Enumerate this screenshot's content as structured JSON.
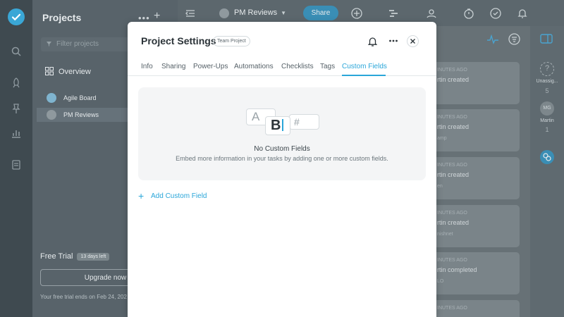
{
  "sidebar": {
    "projects_title": "Projects",
    "more_glyph": "•••",
    "add_glyph": "+",
    "filter_placeholder": "Filter projects",
    "overview_label": "Overview",
    "projects": [
      {
        "label": "Agile Board"
      },
      {
        "label": "PM Reviews"
      }
    ],
    "trial": {
      "title": "Free Trial",
      "days_left": "13 days left",
      "upgrade_label": "Upgrade now",
      "ends_text": "Your free trial ends on Feb 24, 202"
    }
  },
  "topbar": {
    "project_name": "PM Reviews",
    "share_label": "Share"
  },
  "board": {
    "cards": [
      {
        "meta": "INUTES AGO",
        "who": "rtin created",
        "sub": ""
      },
      {
        "meta": "INUTES AGO",
        "who": "rtin created",
        "sub": "amp"
      },
      {
        "meta": "INUTES AGO",
        "who": "rtin created",
        "sub": "en"
      },
      {
        "meta": "INUTES AGO",
        "who": "rtin created",
        "sub": "nishnet"
      },
      {
        "meta": "INUTES AGO",
        "who": "rtin completed",
        "sub": "LO"
      },
      {
        "meta": "INUTES AGO",
        "who": "",
        "sub": ""
      }
    ],
    "assignees": {
      "unassigned_label": "Unassig...",
      "unassigned_count": "5",
      "martin_initials": "MG",
      "martin_label": "Martin",
      "martin_count": "1"
    }
  },
  "modal": {
    "title": "Project Settings",
    "badge": "Team Project",
    "tabs": [
      {
        "label": "Info"
      },
      {
        "label": "Sharing"
      },
      {
        "label": "Power-Ups"
      },
      {
        "label": "Automations"
      },
      {
        "label": "Checklists"
      },
      {
        "label": "Tags"
      },
      {
        "label": "Custom Fields"
      }
    ],
    "active_tab": "Custom Fields",
    "empty": {
      "tile_a": "A",
      "tile_b": "B",
      "tile_hash": "#",
      "title": "No Custom Fields",
      "description": "Embed more information in your tasks by adding one or more custom fields."
    },
    "add_label": "Add Custom Field"
  },
  "colors": {
    "accent": "#2aa6d9",
    "overlay_dark": "#3f4a50"
  }
}
